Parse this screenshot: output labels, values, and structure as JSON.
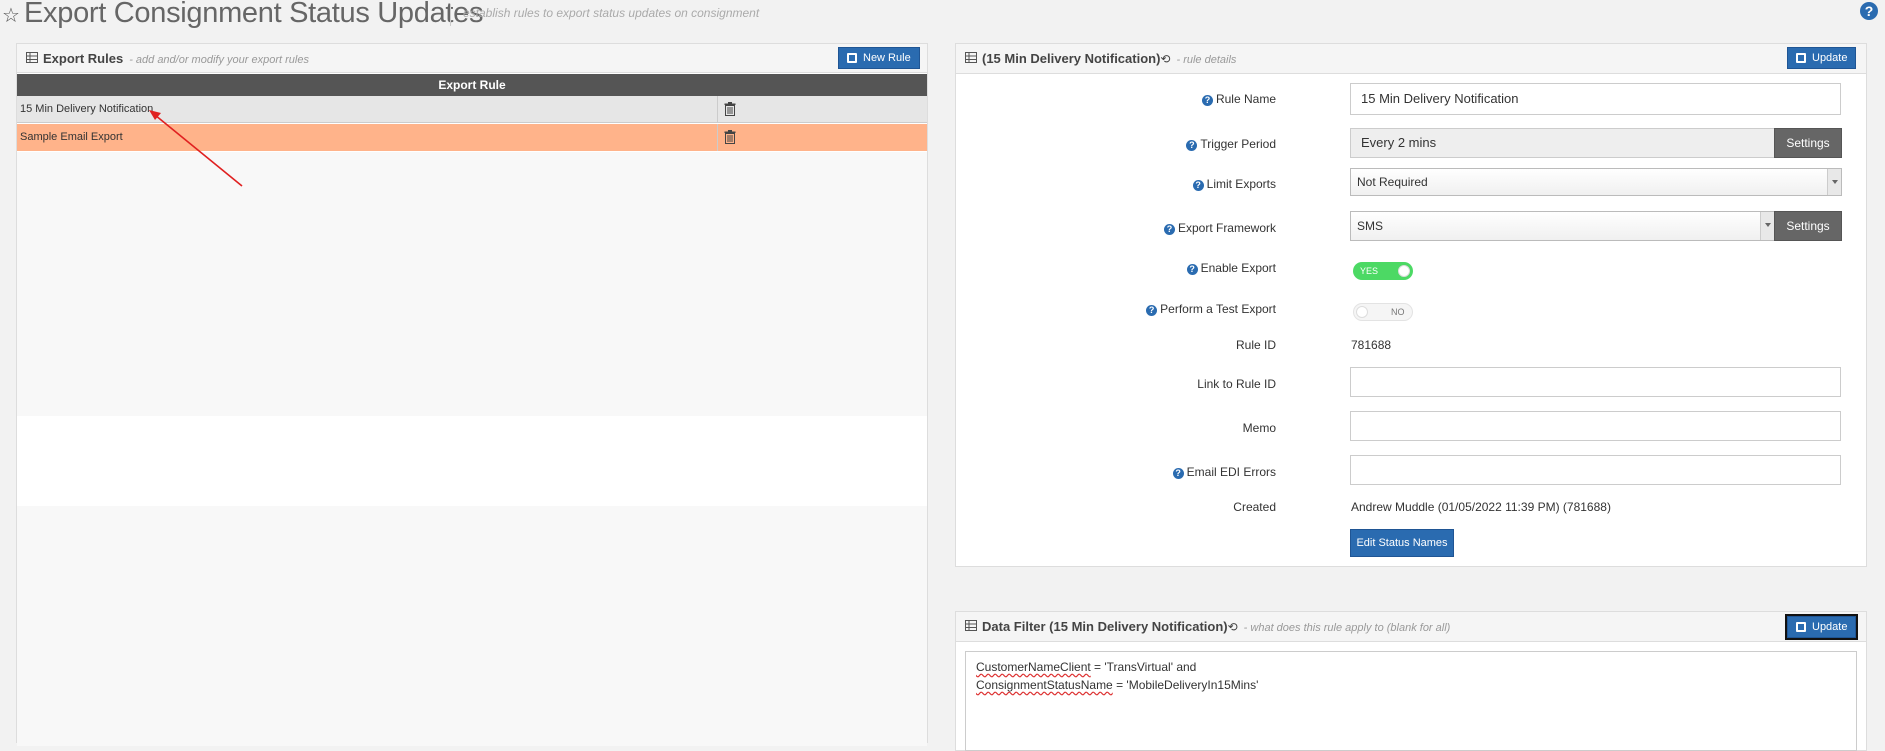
{
  "header": {
    "title": "Export Consignment Status Updates",
    "subtitle": "establish rules to export status updates on consignment",
    "help": "?"
  },
  "rules_panel": {
    "title": "Export Rules",
    "hint": "- add and/or modify your export rules",
    "new_rule_label": "New Rule",
    "column_header": "Export Rule",
    "rows": [
      {
        "name": "15 Min Delivery Notification"
      },
      {
        "name": "Sample Email Export"
      }
    ],
    "selected_row_color": "#ffb38a"
  },
  "details_panel": {
    "title": "(15 Min Delivery Notification)",
    "hint": "- rule details",
    "update_label": "Update",
    "rule_name_label": "Rule Name",
    "rule_name_value": "15 Min Delivery Notification",
    "trigger_label": "Trigger Period",
    "trigger_value": "Every 2 mins",
    "settings_label": "Settings",
    "limit_label": "Limit Exports",
    "limit_value": "Not Required",
    "framework_label": "Export Framework",
    "framework_value": "SMS",
    "enable_label": "Enable Export",
    "enable_state": "YES",
    "test_label": "Perform a Test Export",
    "test_state": "NO",
    "rule_id_label": "Rule ID",
    "rule_id_value": "781688",
    "link_label": "Link to Rule ID",
    "link_value": "",
    "memo_label": "Memo",
    "memo_value": "",
    "email_label": "Email EDI Errors",
    "email_value": "",
    "created_label": "Created",
    "created_value": "Andrew Muddle (01/05/2022 11:39 PM) (781688)",
    "edit_status_label": "Edit Status Names"
  },
  "filter_panel": {
    "title": "Data Filter (15 Min Delivery Notification)",
    "hint": "- what does this rule apply to (blank for all)",
    "update_label": "Update",
    "line1_field": "CustomerNameClient",
    "line1_rest": " = 'TransVirtual' and",
    "line2_field": "ConsignmentStatusName",
    "line2_rest": " = 'MobileDeliveryIn15Mins'"
  },
  "colors": {
    "accent": "#2a6bb0",
    "toggle_on": "#4cd964",
    "annotation_arrow": "#e02020"
  },
  "icons": {
    "star": "star-icon",
    "table": "table-icon",
    "history": "history-icon",
    "trash": "trash-icon",
    "plus": "plus-icon",
    "save": "save-icon",
    "help": "help-icon"
  }
}
